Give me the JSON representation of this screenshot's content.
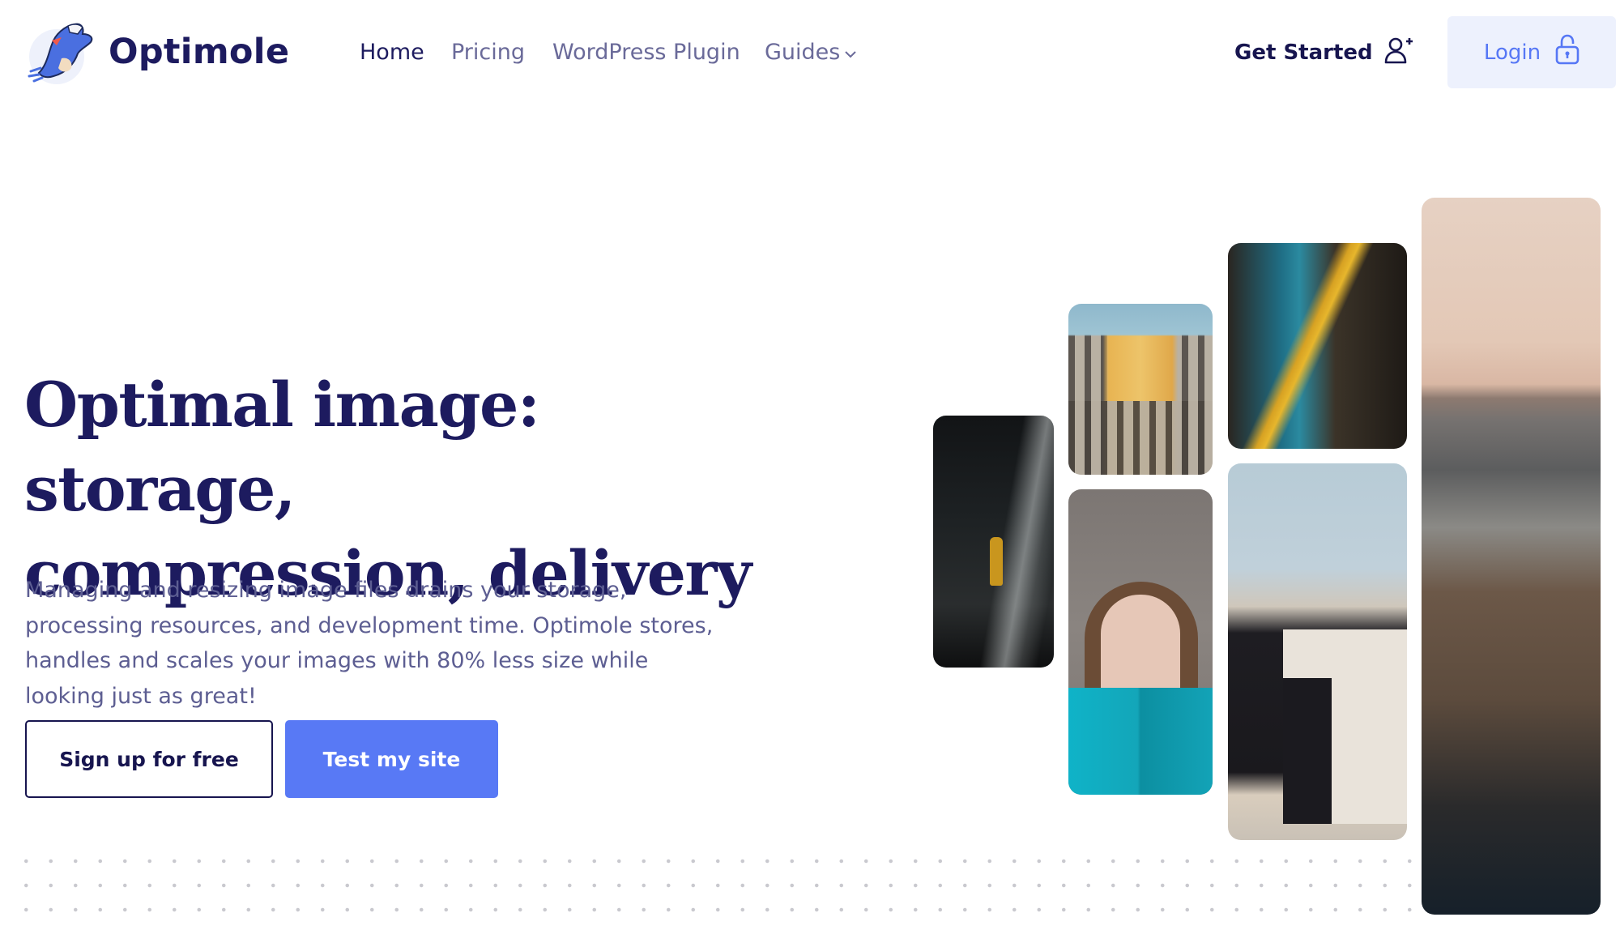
{
  "brand": {
    "name": "Optimole",
    "logo_icon": "mole-mascot-icon"
  },
  "nav": {
    "items": [
      {
        "label": "Home",
        "active": true
      },
      {
        "label": "Pricing",
        "active": false
      },
      {
        "label": "WordPress Plugin",
        "active": false
      },
      {
        "label": "Guides",
        "active": false,
        "has_dropdown": true
      }
    ],
    "get_started": {
      "label": "Get Started",
      "icon": "user-plus-icon"
    },
    "login": {
      "label": "Login",
      "icon": "lock-open-icon"
    }
  },
  "hero": {
    "headline_line1": "Optimal image: storage,",
    "headline_line2": "compression, delivery",
    "description": "Managing and resizing image files drains your storage, processing resources, and development time. Optimole stores, handles and scales your images with 80% less size while looking just as great!",
    "buttons": {
      "signup": "Sign up for free",
      "test": "Test my site"
    }
  },
  "gallery": [
    {
      "subject": "person near waterfall"
    },
    {
      "subject": "building facade with sunlight"
    },
    {
      "subject": "woman holding teal book"
    },
    {
      "subject": "train at station platform"
    },
    {
      "subject": "concrete overpass"
    },
    {
      "subject": "coastline at dusk"
    }
  ],
  "colors": {
    "brand_navy": "#1d1b5f",
    "accent_blue": "#5879f5",
    "login_bg": "#edf1fd",
    "muted_text": "#5d5e92"
  }
}
